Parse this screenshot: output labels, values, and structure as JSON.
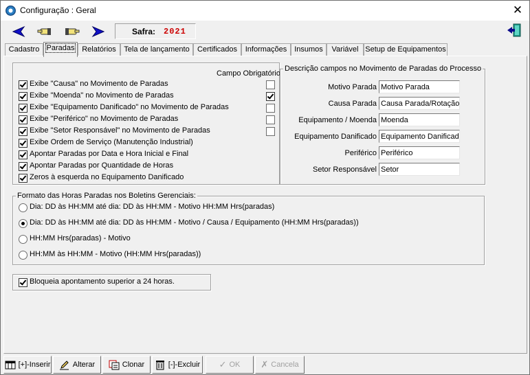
{
  "window": {
    "title": "Configuração : Geral",
    "close_glyph": "✕"
  },
  "toolbar": {
    "icons": [
      "arrow-first-icon",
      "hand-prev-icon",
      "hand-next-icon",
      "arrow-last-icon",
      "exit-door-icon"
    ],
    "safra_label": "Safra:",
    "safra_value": "2021",
    "safra_color": "#cc0000"
  },
  "tabs": [
    {
      "label": "Cadastro",
      "active": false
    },
    {
      "label": "Paradas",
      "active": true
    },
    {
      "label": "Relatórios",
      "active": false
    },
    {
      "label": "Tela de lançamento",
      "active": false
    },
    {
      "label": "Certificados",
      "active": false
    },
    {
      "label": "Informações",
      "active": false
    },
    {
      "label": "Insumos",
      "active": false
    },
    {
      "label": "Variável",
      "active": false
    },
    {
      "label": "Setup de Equipamentos",
      "active": false
    }
  ],
  "options": {
    "mandatory_header": "Campo Obrigatório",
    "items": [
      {
        "label": "Exibe \"Causa\" no Movimento de Paradas",
        "checked": true,
        "mandatory": false
      },
      {
        "label": "Exibe \"Moenda\" no Movimento de Paradas",
        "checked": true,
        "mandatory": true
      },
      {
        "label": "Exibe \"Equipamento Danificado\" no Movimento de Paradas",
        "checked": true,
        "mandatory": false
      },
      {
        "label": "Exibe \"Periférico\" no Movimento de Paradas",
        "checked": true,
        "mandatory": false
      },
      {
        "label": "Exibe \"Setor Responsável\" no Movimento de Paradas",
        "checked": true,
        "mandatory": false
      },
      {
        "label": "Exibe Ordem de Serviço (Manutenção Industrial)",
        "checked": true
      },
      {
        "label": "Apontar Paradas por Data e Hora Inicial e Final",
        "checked": true
      },
      {
        "label": "Apontar Paradas por Quantidade de Horas",
        "checked": true
      },
      {
        "label": "Zeros à esquerda no Equipamento Danificado",
        "checked": true
      }
    ]
  },
  "descriptions": {
    "title": "Descrição campos no Movimento de Paradas do Processo",
    "fields": [
      {
        "label": "Motivo Parada",
        "value": "Motivo Parada"
      },
      {
        "label": "Causa Parada",
        "value": "Causa Parada/Rotação"
      },
      {
        "label": "Equipamento / Moenda",
        "value": "Moenda"
      },
      {
        "label": "Equipamento Danificado",
        "value": "Equipamento Danificado"
      },
      {
        "label": "Periférico",
        "value": "Periférico"
      },
      {
        "label": "Setor Responsável",
        "value": "Setor"
      }
    ]
  },
  "format": {
    "title": "Formato das Horas Paradas nos Boletins Gerenciais:",
    "options": [
      {
        "label": "Dia: DD às HH:MM até dia: DD às HH:MM - Motivo HH:MM Hrs(paradas)",
        "selected": false
      },
      {
        "label": "Dia: DD às HH:MM até dia: DD às HH:MM - Motivo / Causa / Equipamento (HH:MM Hrs(paradas))",
        "selected": true
      },
      {
        "label": "HH:MM Hrs(paradas) - Motivo",
        "selected": false
      },
      {
        "label": "HH:MM às HH:MM - Motivo (HH:MM Hrs(paradas))",
        "selected": false
      }
    ]
  },
  "block_option": {
    "label": "Bloqueia apontamento superior a 24 horas.",
    "checked": true
  },
  "buttons": {
    "insert": "[+]-Inserir",
    "edit": "Alterar",
    "clone": "Clonar",
    "delete": "[-]-Excluir",
    "ok": "OK",
    "cancel": "Cancela"
  }
}
